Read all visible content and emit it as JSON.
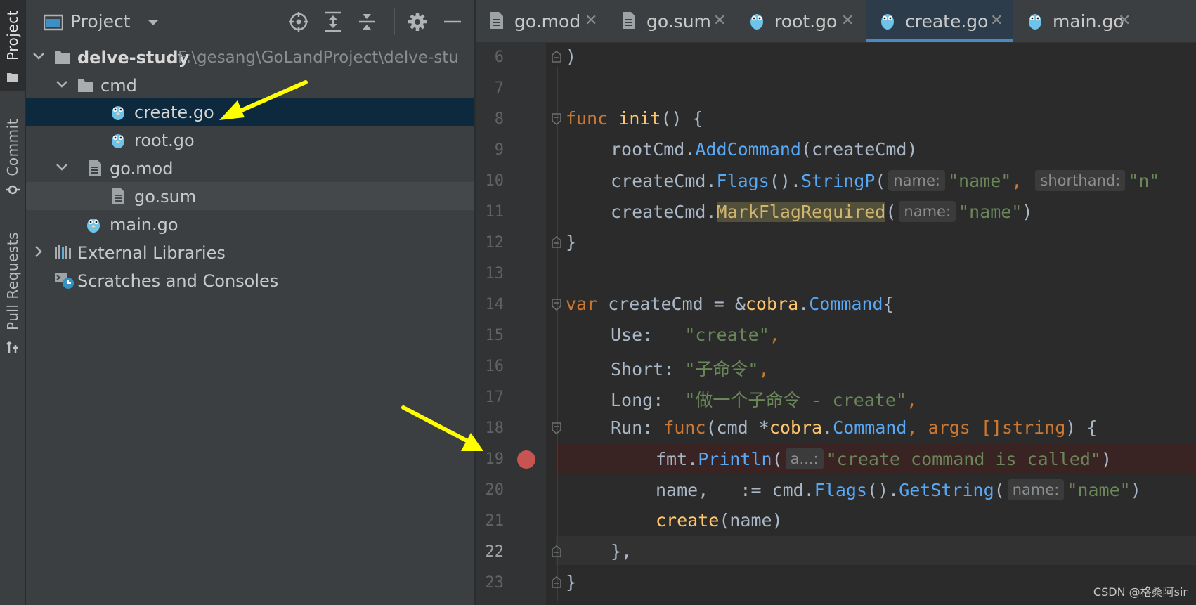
{
  "sidebar_strip": {
    "tabs": [
      {
        "label": "Project",
        "icon": "folder-icon"
      },
      {
        "label": "Commit",
        "icon": "commit-icon"
      },
      {
        "label": "Pull Requests",
        "icon": "pull-request-icon"
      }
    ]
  },
  "project_panel": {
    "title": "Project",
    "toolbar_icons": [
      "locate-icon",
      "expand-all-icon",
      "collapse-all-icon",
      "gear-icon",
      "minimize-icon"
    ],
    "tree": [
      {
        "label": "delve-study",
        "path": "F:\\gesang\\GoLandProject\\delve-stu",
        "type": "root-folder"
      },
      {
        "label": "cmd",
        "type": "folder"
      },
      {
        "label": "create.go",
        "type": "go-file",
        "selected": true
      },
      {
        "label": "root.go",
        "type": "go-file"
      },
      {
        "label": "go.mod",
        "type": "mod-file"
      },
      {
        "label": "go.sum",
        "type": "sum-file"
      },
      {
        "label": "main.go",
        "type": "go-file"
      },
      {
        "label": "External Libraries",
        "type": "libraries"
      },
      {
        "label": "Scratches and Consoles",
        "type": "scratches"
      }
    ]
  },
  "editor": {
    "tabs": [
      {
        "label": "go.mod",
        "active": false
      },
      {
        "label": "go.sum",
        "active": false
      },
      {
        "label": "root.go",
        "active": false
      },
      {
        "label": "create.go",
        "active": true
      },
      {
        "label": "main.go",
        "active": false
      }
    ],
    "line_numbers": [
      "6",
      "7",
      "8",
      "9",
      "10",
      "11",
      "12",
      "13",
      "14",
      "15",
      "16",
      "17",
      "18",
      "19",
      "20",
      "21",
      "22",
      "23"
    ],
    "breakpoint_line": "19",
    "current_line": "22",
    "code": {
      "l6": ")",
      "l8_kw": "func",
      "l8_fn": "init",
      "l8_rest": "() {",
      "l9_a": "rootCmd.",
      "l9_m": "AddCommand",
      "l9_b": "(createCmd)",
      "l10_a": "createCmd.",
      "l10_m1": "Flags",
      "l10_b": "().",
      "l10_m2": "StringP",
      "l10_c": "(",
      "l10_h1": "name:",
      "l10_s1": "\"name\"",
      "l10_comma": ", ",
      "l10_h2": "shorthand:",
      "l10_s2": "\"n\"",
      "l11_a": "createCmd.",
      "l11_m": "MarkFlagRequired",
      "l11_b": "(",
      "l11_h": "name:",
      "l11_s": "\"name\"",
      "l11_c": ")",
      "l12": "}",
      "l14_kw": "var",
      "l14_a": " createCmd = &",
      "l14_pkg": "cobra",
      "l14_dot": ".",
      "l14_t": "Command",
      "l14_b": "{",
      "l15_a": "Use:   ",
      "l15_s": "\"create\"",
      "l15_c": ",",
      "l16_a": "Short: ",
      "l16_s": "\"子命令\"",
      "l16_c": ",",
      "l17_a": "Long:  ",
      "l17_s": "\"做一个子命令 - create\"",
      "l17_c": ",",
      "l18_a": "Run: ",
      "l18_kw": "func",
      "l18_b": "(cmd *",
      "l18_pkg": "cobra",
      "l18_dot": ".",
      "l18_t": "Command",
      "l18_c": ", args []",
      "l18_ty": "string",
      "l18_d": ") {",
      "l19_a": "fmt.",
      "l19_m": "Println",
      "l19_b": "(",
      "l19_h": "a...:",
      "l19_s": "\"create command is called\"",
      "l19_c": ")",
      "l20_a": "name, _ := cmd.",
      "l20_m1": "Flags",
      "l20_b": "().",
      "l20_m2": "GetString",
      "l20_c": "(",
      "l20_h": "name:",
      "l20_s": "\"name\"",
      "l20_d": ")",
      "l21_m": "create",
      "l21_a": "(name)",
      "l22": "},",
      "l23": "}"
    }
  },
  "watermark": "CSDN @格桑阿sir",
  "colors": {
    "accent": "#4a88c7",
    "breakpoint": "#c75450",
    "annotation_arrow": "#ffff00"
  }
}
